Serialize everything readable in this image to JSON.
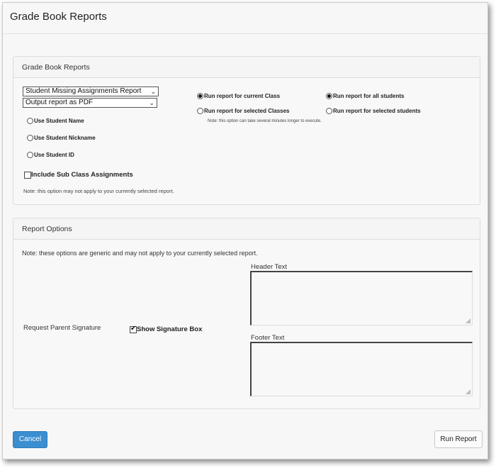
{
  "window": {
    "title": "Grade Book Reports"
  },
  "report_panel": {
    "heading": "Grade Book Reports",
    "report_select": {
      "value": "Student Missing Assignments Report"
    },
    "output_select": {
      "value": "Output report as PDF"
    },
    "name_options": [
      {
        "label": "Use Student Name",
        "selected": false
      },
      {
        "label": "Use Student Nickname",
        "selected": false
      },
      {
        "label": "Use Student ID",
        "selected": false
      }
    ],
    "include_sub_class": {
      "label": "Include Sub Class Assignments",
      "checked": false
    },
    "note": "Note: this option may not apply to your currently selected report.",
    "class_scope": [
      {
        "label": "Run report for current Class",
        "selected": true
      },
      {
        "label": "Run report for selected Classes",
        "selected": false
      }
    ],
    "class_scope_note": "Note: this option can take several minutes longer to execute.",
    "student_scope": [
      {
        "label": "Run report for all students",
        "selected": true
      },
      {
        "label": "Run report for selected students",
        "selected": false
      }
    ]
  },
  "options_panel": {
    "heading": "Report Options",
    "note": "Note: these options are generic and may not apply to your currently selected report.",
    "parent_signature_label": "Request Parent Signature",
    "signature_box": {
      "label": "Show Signature Box",
      "checked": true
    },
    "header_text": {
      "label": "Header Text",
      "value": ""
    },
    "footer_text": {
      "label": "Footer Text",
      "value": ""
    }
  },
  "buttons": {
    "cancel": "Cancel",
    "run": "Run Report"
  },
  "colors": {
    "primary_button": "#3b8ed0",
    "panel_bg": "#f8f8f8"
  }
}
